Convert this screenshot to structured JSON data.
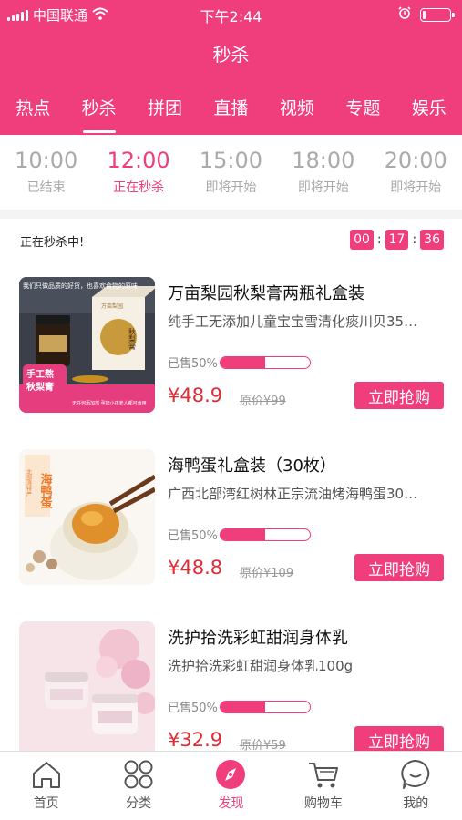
{
  "status_bar": {
    "carrier": "中国联通",
    "time": "下午2:44"
  },
  "header": {
    "title": "秒杀"
  },
  "tabs": [
    {
      "label": "热点",
      "active": false
    },
    {
      "label": "秒杀",
      "active": true
    },
    {
      "label": "拼团",
      "active": false
    },
    {
      "label": "直播",
      "active": false
    },
    {
      "label": "视频",
      "active": false
    },
    {
      "label": "专题",
      "active": false
    },
    {
      "label": "娱乐",
      "active": false
    }
  ],
  "sessions": [
    {
      "time": "10:00",
      "status": "已结束"
    },
    {
      "time": "12:00",
      "status": "正在秒杀"
    },
    {
      "time": "15:00",
      "status": "即将开始"
    },
    {
      "time": "18:00",
      "status": "即将开始"
    },
    {
      "time": "20:00",
      "status": "即将开始"
    }
  ],
  "flash_status": {
    "text": "正在秒杀中!",
    "countdown": {
      "hours": "00",
      "minutes": "17",
      "seconds": "36"
    }
  },
  "products": [
    {
      "name": "万亩梨园秋梨膏两瓶礼盒装",
      "desc": "纯手工无添加儿童宝宝雪清化痰川贝35…",
      "sold_label": "已售50%",
      "sold_fraction": 0.5,
      "price": "¥48.9",
      "orig_price": "原价¥99",
      "buy_label": "立即抢购",
      "image": {
        "tagline": "我们只做品质的好货，也喜欢食物的原味",
        "brand": "万亩梨园",
        "box_text": "秋梨膏",
        "badge_top": "手工熬",
        "badge_bottom": "秋梨膏",
        "footer": "无任何添加剂 孕妇小孩老人都可食用"
      }
    },
    {
      "name": "海鸭蛋礼盒装（30枚）",
      "desc": "广西北部湾红树林正宗流油烤海鸭蛋30…",
      "sold_label": "已售50%",
      "sold_fraction": 0.5,
      "price": "¥48.8",
      "orig_price": "原价¥109",
      "buy_label": "立即抢购",
      "image": {
        "big": "海鸭蛋",
        "small": "北部湾特产"
      }
    },
    {
      "name": "洗护拾洗彩虹甜润身体乳",
      "desc": "洗护拾洗彩虹甜润身体乳100g",
      "sold_label": "已售50%",
      "sold_fraction": 0.5,
      "price": "¥32.9",
      "orig_price": "原价¥59",
      "buy_label": "立即抢购"
    }
  ],
  "tabbar": [
    {
      "label": "首页",
      "icon": "home-icon",
      "active": false
    },
    {
      "label": "分类",
      "icon": "category-icon",
      "active": false
    },
    {
      "label": "发现",
      "icon": "compass-icon",
      "active": true
    },
    {
      "label": "购物车",
      "icon": "cart-icon",
      "active": false
    },
    {
      "label": "我的",
      "icon": "profile-icon",
      "active": false
    }
  ],
  "colors": {
    "accent": "#f03d7c",
    "price": "#e02a34"
  }
}
